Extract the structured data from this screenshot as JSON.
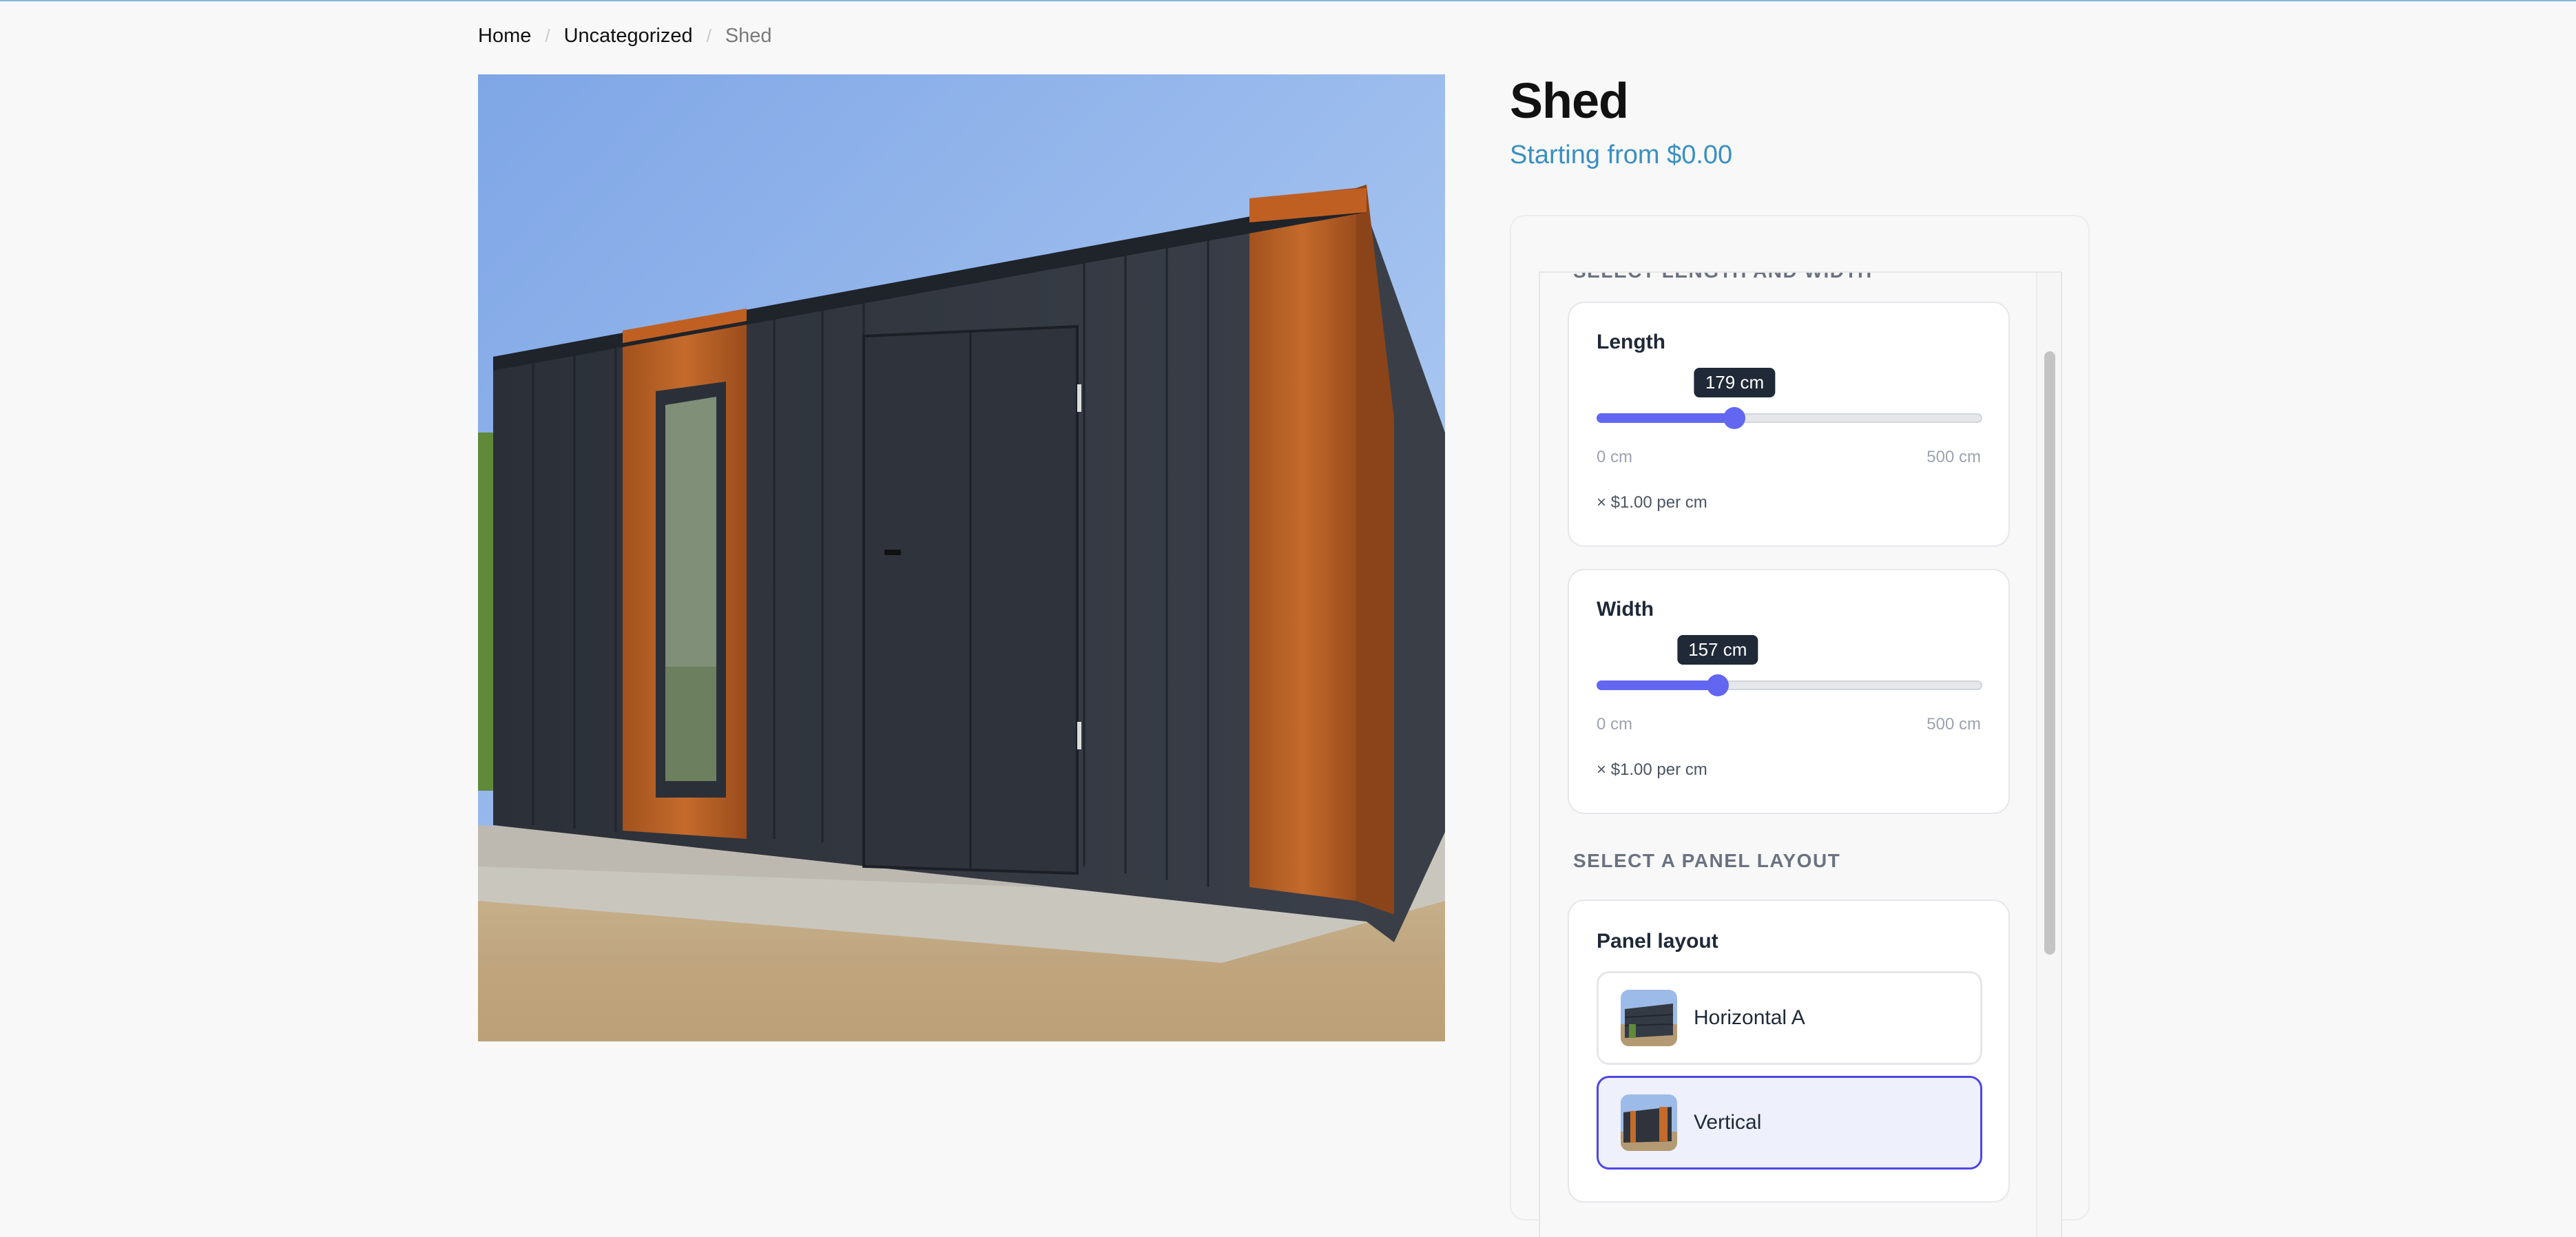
{
  "breadcrumb": {
    "home": "Home",
    "category": "Uncategorized",
    "current": "Shed",
    "separator": "/"
  },
  "product": {
    "title": "Shed",
    "price_text": "Starting from $0.00",
    "image_alt": "Shed with dark vertical panels and wood accents"
  },
  "dimensions_section": {
    "heading": "SELECT LENGTH AND WIDTH"
  },
  "length": {
    "label": "Length",
    "value": 179,
    "value_text": "179 cm",
    "min": 0,
    "max": 500,
    "min_label": "0 cm",
    "max_label": "500 cm",
    "rate_text": "× $1.00 per cm"
  },
  "width": {
    "label": "Width",
    "value": 157,
    "value_text": "157 cm",
    "min": 0,
    "max": 500,
    "min_label": "0 cm",
    "max_label": "500 cm",
    "rate_text": "× $1.00 per cm"
  },
  "panel_section": {
    "heading": "SELECT A PANEL LAYOUT",
    "card_label": "Panel layout",
    "options": [
      {
        "label": "Horizontal A",
        "selected": false
      },
      {
        "label": "Vertical",
        "selected": true
      }
    ]
  },
  "colors": {
    "accent": "#6366f1",
    "price": "#3a8fc1",
    "selected_border": "#4f46e5"
  }
}
